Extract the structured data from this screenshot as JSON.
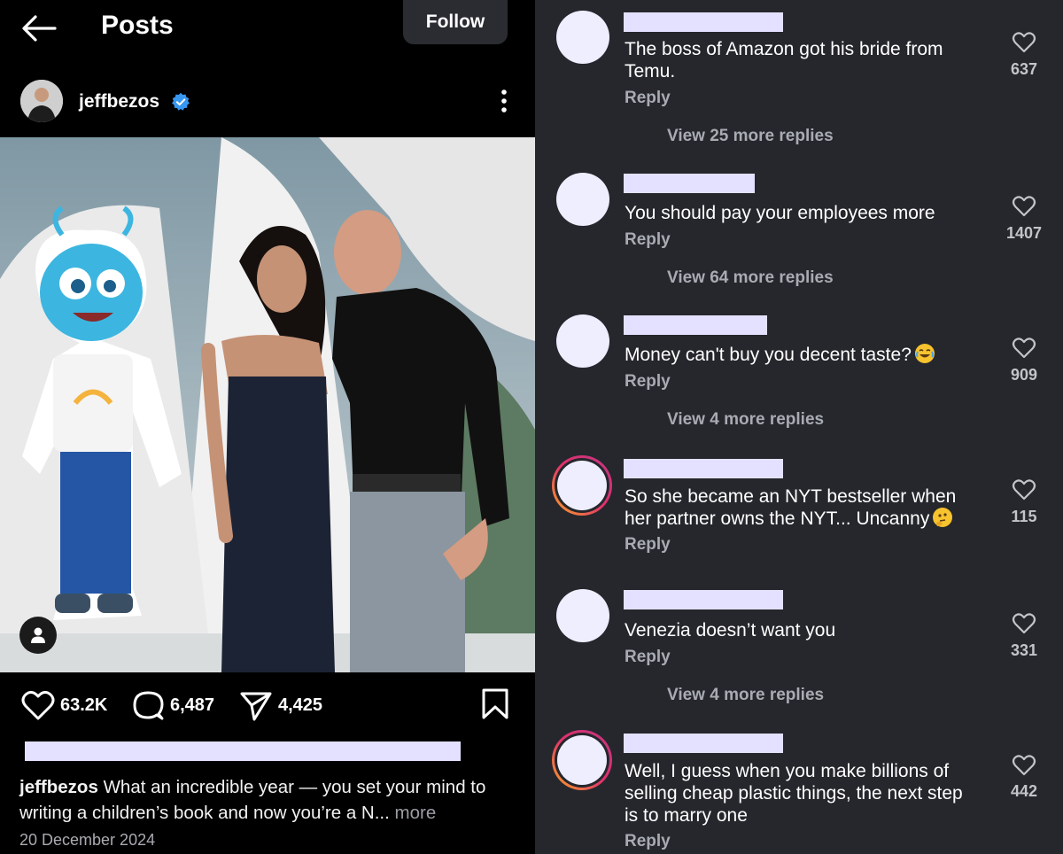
{
  "header": {
    "title": "Posts",
    "follow_label": "Follow"
  },
  "post": {
    "username": "jeffbezos",
    "likes": "63.2K",
    "comments": "6,487",
    "shares": "4,425",
    "caption_user": "jeffbezos",
    "caption_text": "What an incredible year — you set your mind to writing a children’s book and now you’re a N...",
    "caption_more": "more",
    "date": "20 December 2024"
  },
  "comments": [
    {
      "text": "The boss of Amazon got his bride from Temu.",
      "reply": "Reply",
      "likes": "637",
      "view_replies": "View 25 more replies",
      "story_ring": false
    },
    {
      "text": "You should pay your employees more",
      "reply": "Reply",
      "likes": "1407",
      "view_replies": "View 64 more replies",
      "story_ring": false
    },
    {
      "text": "Money can't buy you decent taste?",
      "emoji": "face-with-tears-of-joy-icon",
      "reply": "Reply",
      "likes": "909",
      "view_replies": "View 4 more replies",
      "story_ring": false
    },
    {
      "text": "So she became an NYT bestseller when her partner owns the NYT... Uncanny",
      "emoji": "thinking-face-icon",
      "reply": "Reply",
      "likes": "115",
      "story_ring": true
    },
    {
      "text": "Venezia doesn’t want you",
      "reply": "Reply",
      "likes": "331",
      "view_replies": "View 4 more replies",
      "story_ring": false
    },
    {
      "text": "Well, I guess when you make billions of selling cheap plastic things, the next step is to marry one",
      "reply": "Reply",
      "likes": "442",
      "story_ring": true
    }
  ],
  "colors": {
    "panel_right": "#25272c",
    "redaction": "#e3e1ff",
    "verified": "#3897f0",
    "muted": "#a9abb3"
  }
}
